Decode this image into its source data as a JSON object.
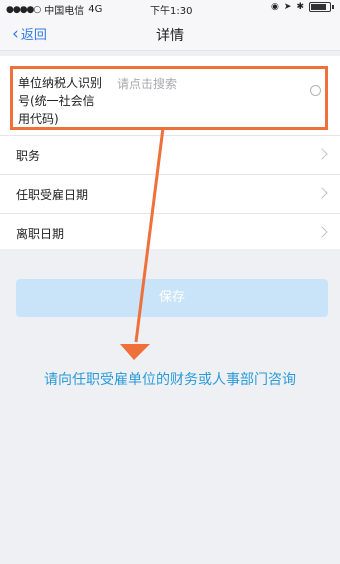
{
  "status_bar": {
    "signal": "●●●●○",
    "carrier": "中国电信",
    "network": "4G",
    "time": "下午1:30"
  },
  "nav": {
    "back_label": "返回",
    "title": "详情"
  },
  "form": {
    "tax_id_label": "单位纳税人识别号(统一社会信用代码)",
    "tax_id_placeholder": "请点击搜索",
    "rows": [
      {
        "label": "职务"
      },
      {
        "label": "任职受雇日期"
      },
      {
        "label": "离职日期"
      }
    ],
    "save_label": "保存"
  },
  "annotation": {
    "hint": "请向任职受雇单位的财务或人事部门咨询",
    "arrow_color": "#f0703b",
    "box_color": "#f0703b"
  },
  "colors": {
    "accent": "#2f7be2",
    "save_button_bg": "#c9e4f8",
    "hint_text": "#2a9bd8"
  }
}
